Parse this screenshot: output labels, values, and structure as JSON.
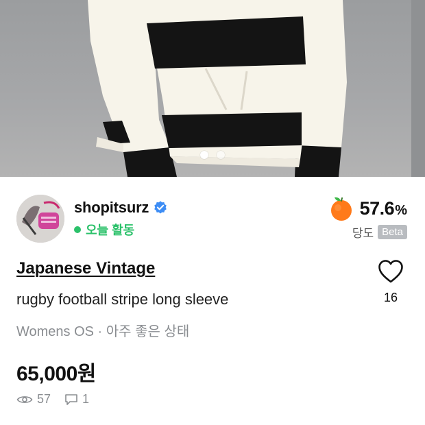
{
  "photo": {
    "active_slide": 1,
    "slide_count": 2,
    "colors": {
      "background": "#a3a5a7",
      "shirt_white": "#f7f4ea",
      "stripe_black": "#141414"
    }
  },
  "seller": {
    "name": "shopitsurz",
    "verified": true,
    "activity": "오늘 활동",
    "activity_color": "#2bc16a",
    "temperature": {
      "value": "57.6",
      "unit": "%",
      "label": "당도",
      "badge": "Beta",
      "icon": "orange-fruit-icon"
    }
  },
  "product": {
    "title": "Japanese Vintage",
    "description": "rugby football stripe long sleeve",
    "meta": "Womens OS · 아주 좋은 상태",
    "price": "65,000원",
    "likes": "16",
    "views": "57",
    "comments": "1"
  }
}
